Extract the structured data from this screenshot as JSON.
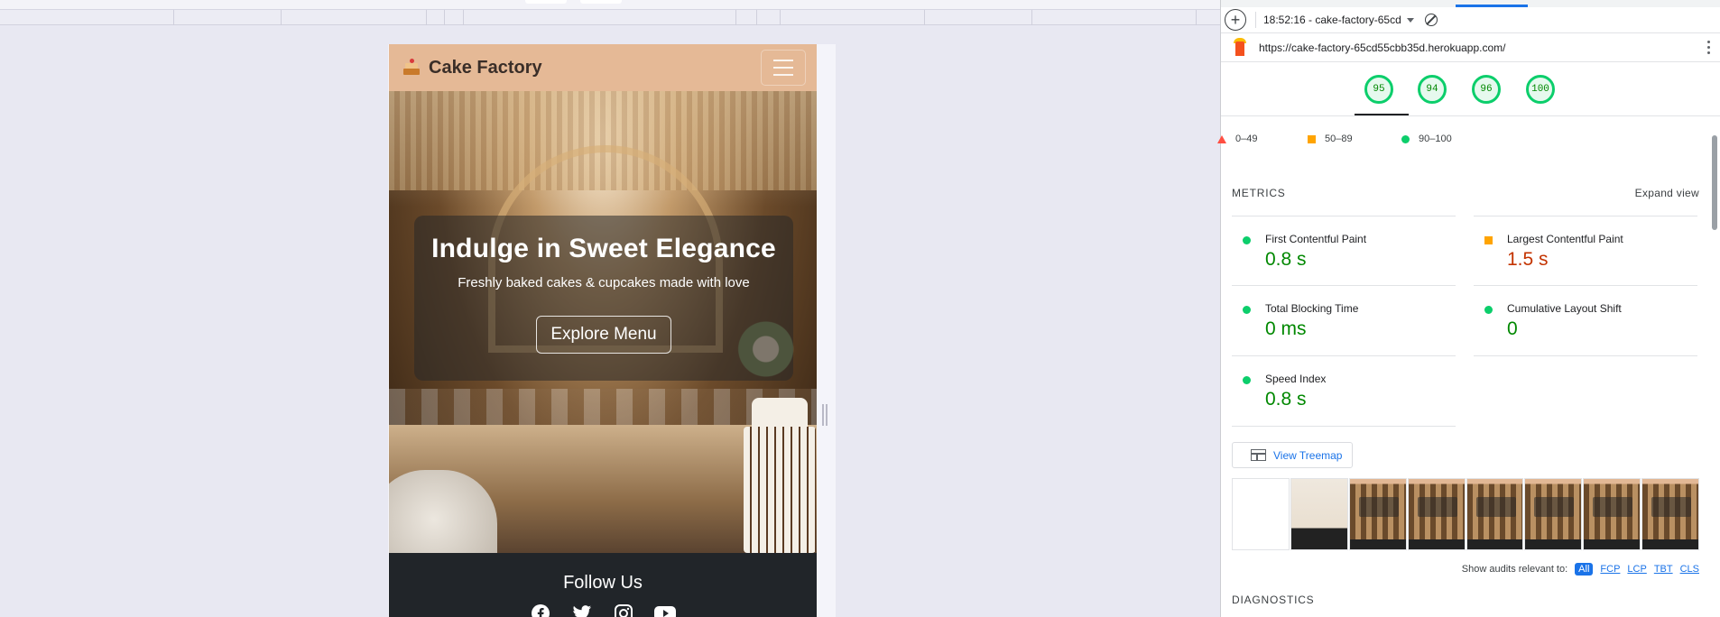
{
  "page": {
    "brand": "Cake Factory",
    "hero": {
      "title": "Indulge in Sweet Elegance",
      "subtitle": "Freshly baked cakes & cupcakes made with love",
      "cta": "Explore Menu"
    },
    "footer": {
      "title": "Follow Us",
      "social": [
        "facebook-icon",
        "twitter-icon",
        "instagram-icon",
        "youtube-icon"
      ]
    }
  },
  "devtools": {
    "report_label": "18:52:16 - cake-factory-65cd",
    "url": "https://cake-factory-65cd55cbb35d.herokuapp.com/",
    "scores": [
      {
        "value": "95"
      },
      {
        "value": "94"
      },
      {
        "value": "96"
      },
      {
        "value": "100"
      }
    ],
    "legend": [
      {
        "range": "0–49",
        "shape": "triangle",
        "color": "#ff4e42"
      },
      {
        "range": "50–89",
        "shape": "square",
        "color": "#ffa400"
      },
      {
        "range": "90–100",
        "shape": "circle",
        "color": "#0cce6b"
      }
    ],
    "metrics_title": "METRICS",
    "expand_view": "Expand view",
    "metrics": [
      {
        "label": "First Contentful Paint",
        "value": "0.8 s",
        "status": "pass"
      },
      {
        "label": "Largest Contentful Paint",
        "value": "1.5 s",
        "status": "average"
      },
      {
        "label": "Total Blocking Time",
        "value": "0 ms",
        "status": "pass"
      },
      {
        "label": "Cumulative Layout Shift",
        "value": "0",
        "status": "pass"
      },
      {
        "label": "Speed Index",
        "value": "0.8 s",
        "status": "pass"
      }
    ],
    "view_treemap": "View Treemap",
    "show_audits_label": "Show audits relevant to:",
    "audit_filters": [
      "All",
      "FCP",
      "LCP",
      "TBT",
      "CLS"
    ],
    "diagnostics_title": "DIAGNOSTICS",
    "colors": {
      "pass": "#008800",
      "average": "#c33300",
      "accent": "#1a73e8"
    }
  }
}
